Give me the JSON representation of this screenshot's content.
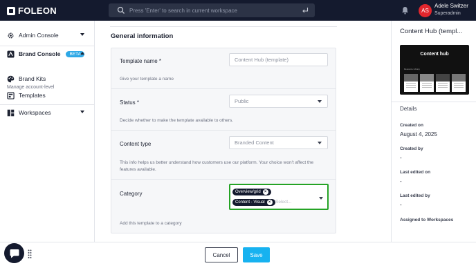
{
  "brand": {
    "name": "FOLEON"
  },
  "search": {
    "placeholder": "Press 'Enter' to search in current workspace"
  },
  "user": {
    "initials": "AS",
    "name": "Adele Switzer",
    "role": "Superadmin"
  },
  "sidebar": {
    "items": [
      {
        "label": "Admin Console"
      },
      {
        "label": "Brand Console",
        "badge": "BETA"
      },
      {
        "label": "Brand Kits"
      },
      {
        "label": "Templates"
      },
      {
        "label": "Workspaces"
      }
    ],
    "manage_label": "Manage account-level"
  },
  "main": {
    "section_title": "General information",
    "template_name": {
      "label": "Template name *",
      "placeholder": "Content Hub (template)",
      "help": "Give your template a name"
    },
    "status": {
      "label": "Status *",
      "value": "Public",
      "help": "Decide whether to make the template available to others."
    },
    "content_type": {
      "label": "Content type",
      "value": "Branded Content",
      "help_line1": "This info helps us better understand how customers use our platform. Your choice won't affect the",
      "help_line2": "features available."
    },
    "category": {
      "label": "Category",
      "chips": [
        "Overview/grid",
        "Content - Visual"
      ],
      "placeholder": "Select...",
      "help": "Add this template to a category"
    }
  },
  "right_panel": {
    "title": "Content Hub (templ...",
    "thumbnail": {
      "title": "Content hub",
      "subtitle": "Resource Library"
    },
    "details_label": "Details",
    "created_on_label": "Created on",
    "created_on_value": "August 4, 2025",
    "created_by_label": "Created by",
    "created_by_value": "-",
    "last_edited_on_label": "Last edited on",
    "last_edited_on_value": "-",
    "last_edited_by_label": "Last edited by",
    "last_edited_by_value": "-",
    "assigned_label": "Assigned to Workspaces"
  },
  "footer": {
    "cancel_label": "Cancel",
    "save_label": "Save"
  },
  "colors": {
    "topbar": "#141a2e",
    "accent": "#17b2f0",
    "beta_badge": "#2ea8e6",
    "avatar": "#e1262d",
    "highlight": "#25a325"
  },
  "icons": [
    "search-icon",
    "enter-icon",
    "bell-icon",
    "gear-icon",
    "brand-console-icon",
    "palette-icon",
    "templates-icon",
    "workspaces-icon",
    "chevron-down-icon",
    "chevron-up-icon",
    "chat-icon",
    "drag-handle-icon"
  ]
}
